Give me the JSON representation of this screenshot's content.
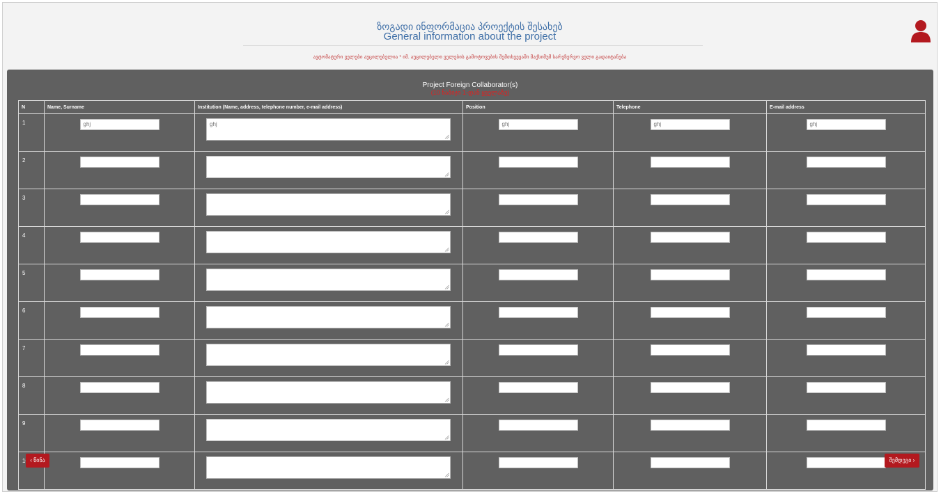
{
  "header": {
    "title_ka": "ზოგადი ინფორმაცია პროექტის შესახებ",
    "title_en": "General information about the project",
    "notice": "ავტომატური ველები აუცილებელია * იმ. აუცილებელი ველების გამოტოვების შემთხვევაში მაქსიმუმ სარეზერვო ველი გადაიტანება"
  },
  "panel": {
    "title": "Project Foreign Collaborator(s)",
    "subtitle": "(10 ნაბიჯი 1-დან ყველაზე)"
  },
  "table": {
    "columns": [
      "N",
      "Name, Surname",
      "Institution (Name, address, telephone number, e-mail address)",
      "Position",
      "Telephone",
      "E-mail address"
    ],
    "rows": [
      {
        "n": "1",
        "name": "ghj",
        "institution": "ghj",
        "position": "ghj",
        "telephone": "ghj",
        "email": "ghj"
      },
      {
        "n": "2",
        "name": "",
        "institution": "",
        "position": "",
        "telephone": "",
        "email": ""
      },
      {
        "n": "3",
        "name": "",
        "institution": "",
        "position": "",
        "telephone": "",
        "email": ""
      },
      {
        "n": "4",
        "name": "",
        "institution": "",
        "position": "",
        "telephone": "",
        "email": ""
      },
      {
        "n": "5",
        "name": "",
        "institution": "",
        "position": "",
        "telephone": "",
        "email": ""
      },
      {
        "n": "6",
        "name": "",
        "institution": "",
        "position": "",
        "telephone": "",
        "email": ""
      },
      {
        "n": "7",
        "name": "",
        "institution": "",
        "position": "",
        "telephone": "",
        "email": ""
      },
      {
        "n": "8",
        "name": "",
        "institution": "",
        "position": "",
        "telephone": "",
        "email": ""
      },
      {
        "n": "9",
        "name": "",
        "institution": "",
        "position": "",
        "telephone": "",
        "email": ""
      },
      {
        "n": "10",
        "name": "",
        "institution": "",
        "position": "",
        "telephone": "",
        "email": ""
      }
    ]
  },
  "buttons": {
    "back_label": "‹ წინა",
    "next_label": "შემდეგი ›"
  },
  "icons": {
    "user": "user-icon",
    "resize": "resize-grip-icon"
  },
  "colors": {
    "accent": "#b3191f",
    "title": "#3f6fa7",
    "panel": "#606060",
    "notice": "#c23b3b"
  }
}
